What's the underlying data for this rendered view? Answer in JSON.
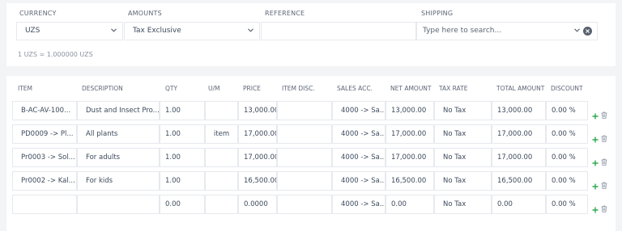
{
  "header": {
    "currency_label": "CURRENCY",
    "amounts_label": "AMOUNTS",
    "reference_label": "REFERENCE",
    "shipping_label": "SHIPPING",
    "currency_value": "UZS",
    "amounts_value": "Tax Exclusive",
    "reference_value": "",
    "shipping_placeholder": "Type here to search...",
    "exchange_rate": "1 UZS = 1.000000 UZS"
  },
  "columns": [
    "ITEM",
    "DESCRIPTION",
    "QTY",
    "U/M",
    "PRICE",
    "ITEM DISC.",
    "SALES ACC.",
    "NET AMOUNT",
    "TAX RATE",
    "TOTAL AMOUNT",
    "DISCOUNT"
  ],
  "rows": [
    {
      "item": "B-AC-AV-100...",
      "description": "Dust and Insect Pro...",
      "qty": "1.00",
      "um": "",
      "price": "13,000.00",
      "item_disc": "",
      "sales_acc": "4000 -> Sa...",
      "net_amount": "13,000.00",
      "tax_rate": "No Tax",
      "total_amount": "13,000.00",
      "discount": "0.00 %"
    },
    {
      "item": "PD0009 -> Pl...",
      "description": "All plants",
      "qty": "1.00",
      "um": "item",
      "price": "17,000.00",
      "item_disc": "",
      "sales_acc": "4000 -> Sa...",
      "net_amount": "17,000.00",
      "tax_rate": "No Tax",
      "total_amount": "17,000.00",
      "discount": "0.00 %"
    },
    {
      "item": "Pr0003 -> Sol...",
      "description": "For adults",
      "qty": "1.00",
      "um": "",
      "price": "17,000.00",
      "item_disc": "",
      "sales_acc": "4000 -> Sa...",
      "net_amount": "17,000.00",
      "tax_rate": "No Tax",
      "total_amount": "17,000.00",
      "discount": "0.00 %"
    },
    {
      "item": "Pr0002 -> Kal...",
      "description": "For kids",
      "qty": "1.00",
      "um": "",
      "price": "16,500.00",
      "item_disc": "",
      "sales_acc": "4000 -> Sa...",
      "net_amount": "16,500.00",
      "tax_rate": "No Tax",
      "total_amount": "16,500.00",
      "discount": "0.00 %"
    },
    {
      "item": "",
      "description": "",
      "qty": "0.00",
      "um": "",
      "price": "0.0000",
      "item_disc": "",
      "sales_acc": "4000 -> Sa...",
      "net_amount": "0.00",
      "tax_rate": "No Tax",
      "total_amount": "0.00",
      "discount": "0.00 %"
    }
  ],
  "icons": {
    "add": "plus-icon",
    "delete": "trash-icon",
    "dropdown": "chevron-down-icon",
    "clear": "clear-icon"
  },
  "colors": {
    "add_icon": "#2fa84f",
    "trash_icon": "#8a94a1",
    "clear_icon": "#5a6270"
  }
}
